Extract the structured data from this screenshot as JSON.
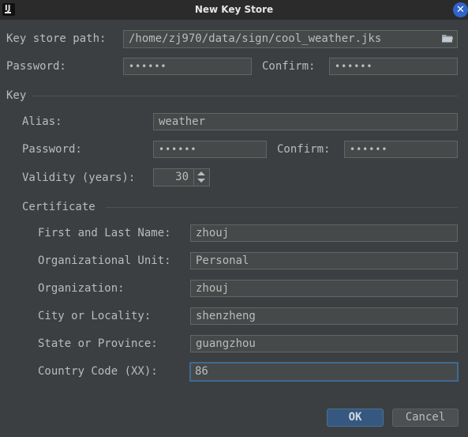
{
  "window": {
    "title": "New Key Store",
    "close_glyph": "✕",
    "app_icon_glyph": "IJ"
  },
  "keystore": {
    "path_label": "Key store path:",
    "path_value": "/home/zj970/data/sign/cool_weather.jks",
    "password_label": "Password:",
    "password_value": "••••••",
    "confirm_label": "Confirm:",
    "confirm_value": "••••••"
  },
  "key": {
    "section_label": "Key",
    "alias_label": "Alias:",
    "alias_value": "weather",
    "password_label": "Password:",
    "password_value": "••••••",
    "confirm_label": "Confirm:",
    "confirm_value": "••••••",
    "validity_label": "Validity (years):",
    "validity_value": "30"
  },
  "certificate": {
    "section_label": "Certificate",
    "first_last_label": "First and Last Name:",
    "first_last_value": "zhouj",
    "org_unit_label": "Organizational Unit:",
    "org_unit_value": "Personal",
    "organization_label": "Organization:",
    "organization_value": "zhouj",
    "city_label": "City or Locality:",
    "city_value": "shenzheng",
    "state_label": "State or Province:",
    "state_value": "guangzhou",
    "country_label": "Country Code (XX):",
    "country_value": "86"
  },
  "buttons": {
    "ok_label": "OK",
    "cancel_label": "Cancel"
  },
  "colors": {
    "background": "#3c3f41",
    "field": "#45494a",
    "accent": "#365880",
    "close": "#2f65ca"
  },
  "icons": {
    "browse": "folder-icon",
    "close": "close-icon"
  }
}
